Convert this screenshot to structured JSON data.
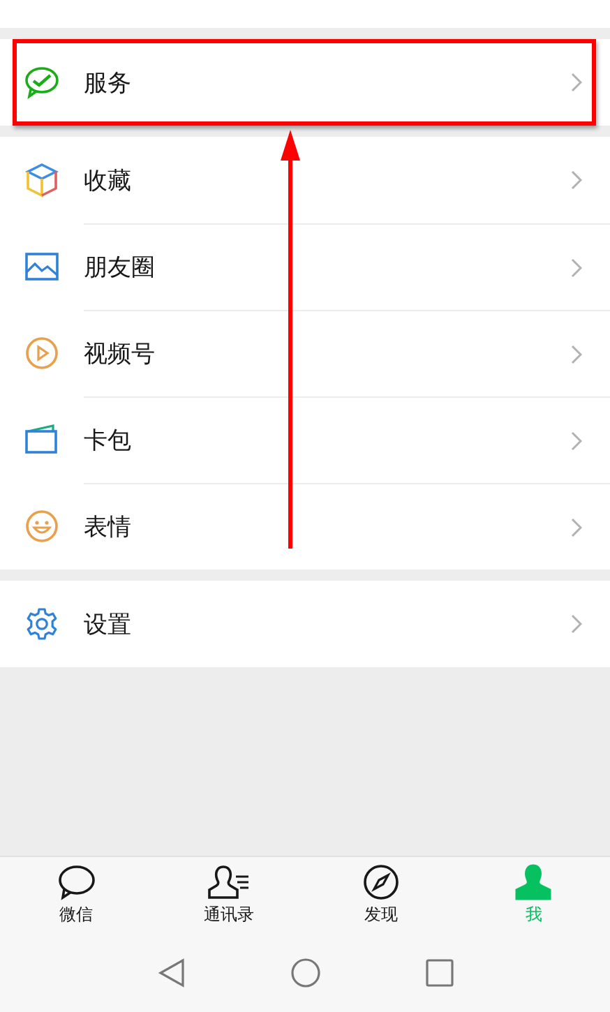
{
  "groups": [
    {
      "items": [
        {
          "label": "服务",
          "kind": "service",
          "highlighted": true
        }
      ]
    },
    {
      "items": [
        {
          "label": "收藏",
          "kind": "favorites",
          "highlighted": false
        },
        {
          "label": "朋友圈",
          "kind": "moments",
          "highlighted": false
        },
        {
          "label": "视频号",
          "kind": "channels",
          "highlighted": false
        },
        {
          "label": "卡包",
          "kind": "cards",
          "highlighted": false
        },
        {
          "label": "表情",
          "kind": "stickers",
          "highlighted": false
        }
      ]
    },
    {
      "items": [
        {
          "label": "设置",
          "kind": "settings",
          "highlighted": false
        }
      ]
    }
  ],
  "tabs": [
    {
      "label": "微信",
      "kind": "chat",
      "selected": false
    },
    {
      "label": "通讯录",
      "kind": "contacts",
      "selected": false
    },
    {
      "label": "发现",
      "kind": "discover",
      "selected": false
    },
    {
      "label": "我",
      "kind": "me",
      "selected": true
    }
  ]
}
